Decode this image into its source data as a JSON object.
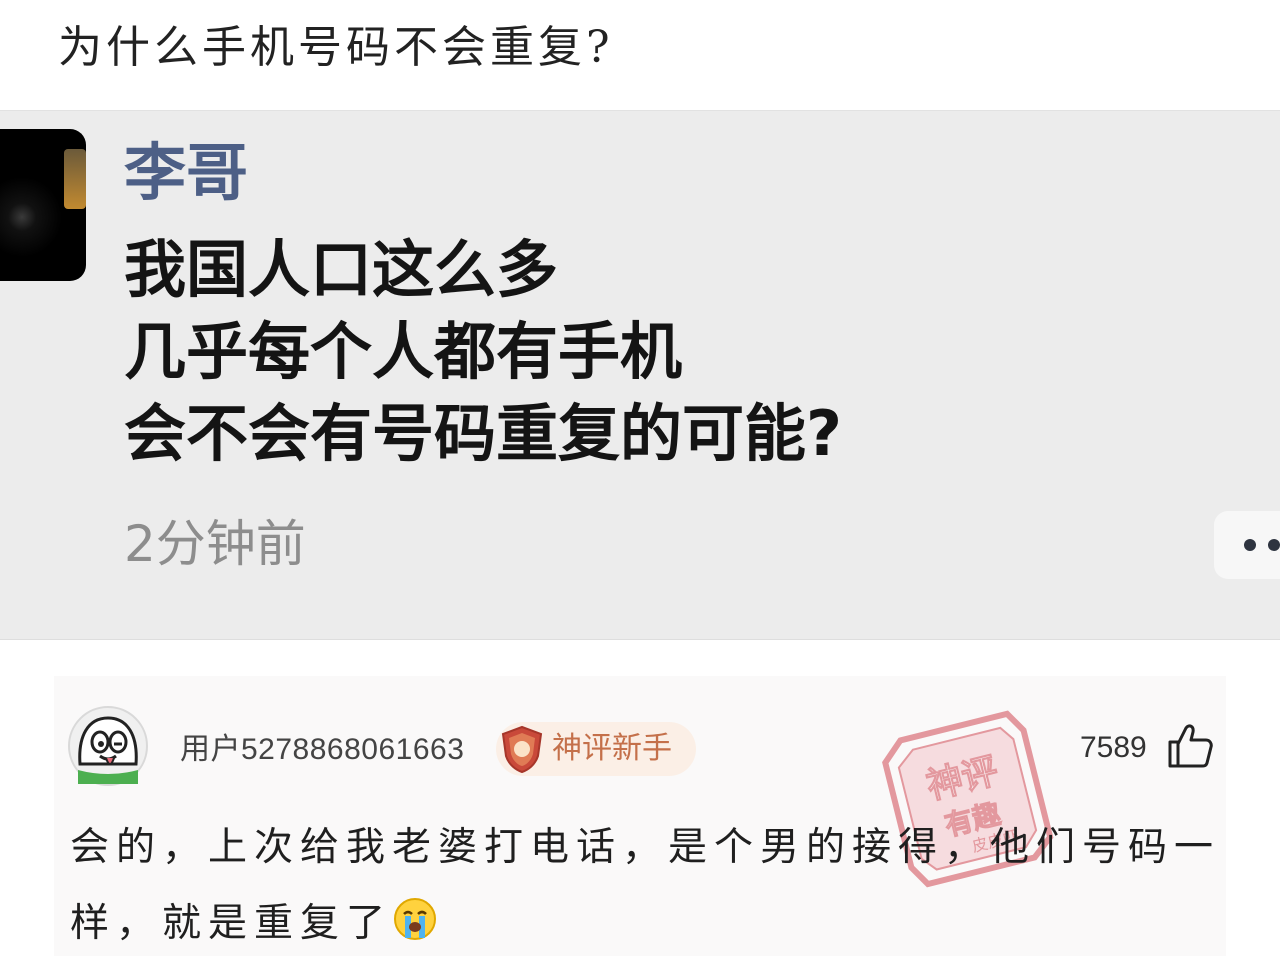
{
  "question": {
    "title": "为什么手机号码不会重复?"
  },
  "post": {
    "author": "李哥",
    "lines": [
      "我国人口这么多",
      "几乎每个人都有手机",
      "会不会有号码重复的可能?"
    ],
    "time": "2分钟前",
    "author_color": "#4d5f86"
  },
  "comment": {
    "username": "用户5278868061663",
    "badge": "神评新手",
    "likes": "7589",
    "text": "会的，上次给我老婆打电话，是个男的接得，他们号码一样，就是重复了",
    "emoji": "crying-face-icon",
    "badge_color": "#c4704a"
  },
  "stamp": {
    "line1": "神评",
    "line2": "有趣",
    "line3": "皮皮虾"
  }
}
